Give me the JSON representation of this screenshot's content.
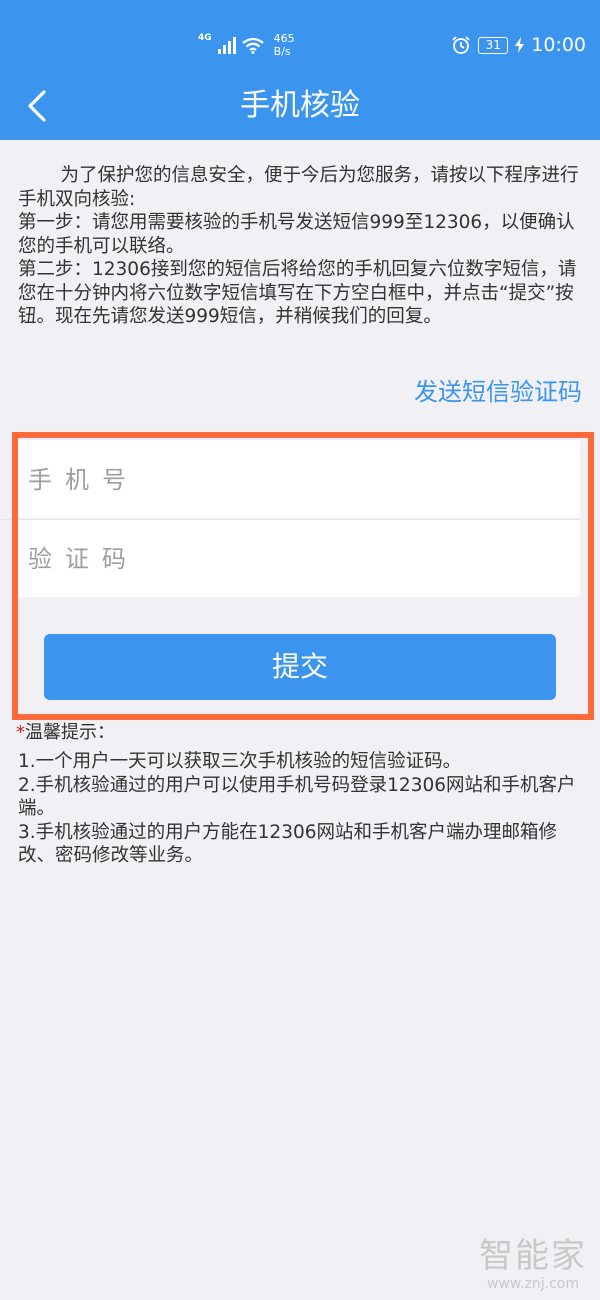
{
  "status_bar": {
    "network_type": "4G",
    "speed_value": "465",
    "speed_unit": "B/s",
    "battery": "31",
    "time": "10:00"
  },
  "nav": {
    "back_icon": "chevron-left-icon",
    "title": "手机核验"
  },
  "intro": {
    "paragraph": "为了保护您的信息安全，便于今后为您服务，请按以下程序进行手机双向核验:",
    "step1": "第一步：请您用需要核验的手机号发送短信999至12306，以便确认您的手机可以联络。",
    "step2": "第二步：12306接到您的短信后将给您的手机回复六位数字短信，请您在十分钟内将六位数字短信填写在下方空白框中，并点击“提交”按钮。现在先请您发送999短信，并稍候我们的回复。"
  },
  "send_code_link": "发送短信验证码",
  "form": {
    "phone_placeholder": "手机号",
    "phone_value": "",
    "code_placeholder": "验证码",
    "code_value": "",
    "submit_label": "提交"
  },
  "tips": {
    "star": "*",
    "title": "温馨提示：",
    "items": [
      "1.一个用户一天可以获取三次手机核验的短信验证码。",
      "2.手机核验通过的用户可以使用手机号码登录12306网站和手机客户端。",
      "3.手机核验通过的用户方能在12306网站和手机客户端办理邮箱修改、密码修改等业务。"
    ]
  },
  "watermark": {
    "logo": "智能家",
    "url": "www.znj.com"
  },
  "colors": {
    "primary": "#3b95ee",
    "highlight": "#ff6a3a",
    "background": "#f0f0f5"
  }
}
